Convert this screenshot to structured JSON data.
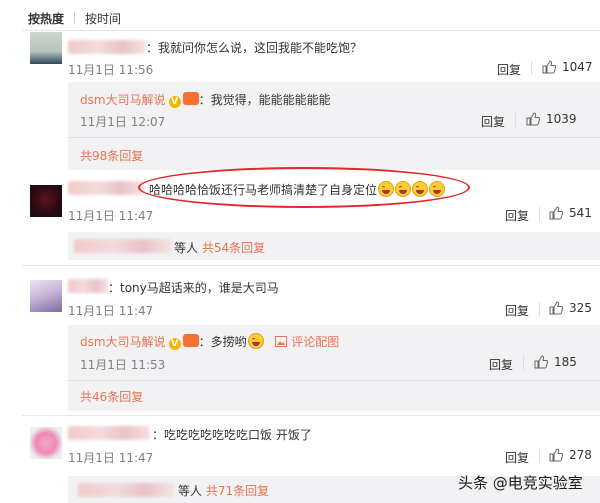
{
  "sort": {
    "hot": "按热度",
    "time": "按时间"
  },
  "reply_label": "回复",
  "comments": [
    {
      "text": "：我就问你怎么说，这回我能不能吃饱？",
      "time": "11月1日 11:56",
      "likes": "1047"
    },
    {
      "text": "哈哈哈哈恰饭还行马老师搞清楚了自身定位",
      "time": "11月1日 11:47",
      "likes": "541"
    },
    {
      "text": "：tony马超话来的，谁是大司马",
      "time": "11月1日 11:47",
      "likes": "325"
    },
    {
      "text": "：吃吃吃吃吃吃吃口饭 开饭了",
      "time": "11月1日 11:47",
      "likes": "278"
    }
  ],
  "subreplies": [
    {
      "author": "dsm大司马解说",
      "text": "：我觉得，能能能能能能",
      "time": "11月1日 12:07",
      "likes": "1039",
      "more": "共98条回复"
    },
    {
      "author": "dsm大司马解说",
      "text": "：多捞哟",
      "extra": "评论配图",
      "time": "11月1日 11:53",
      "likes": "185",
      "more": "共46条回复"
    }
  ],
  "summaries": [
    {
      "suffix": "等人",
      "more": "共54条回复"
    },
    {
      "suffix": "等人",
      "more": "共71条回复"
    }
  ],
  "watermark": {
    "icon": "头条",
    "text": "头条 @电竞实验室"
  },
  "colors": {
    "accent": "#eb7350",
    "highlight": "#e2262a",
    "subbg": "#f2f2f5"
  }
}
